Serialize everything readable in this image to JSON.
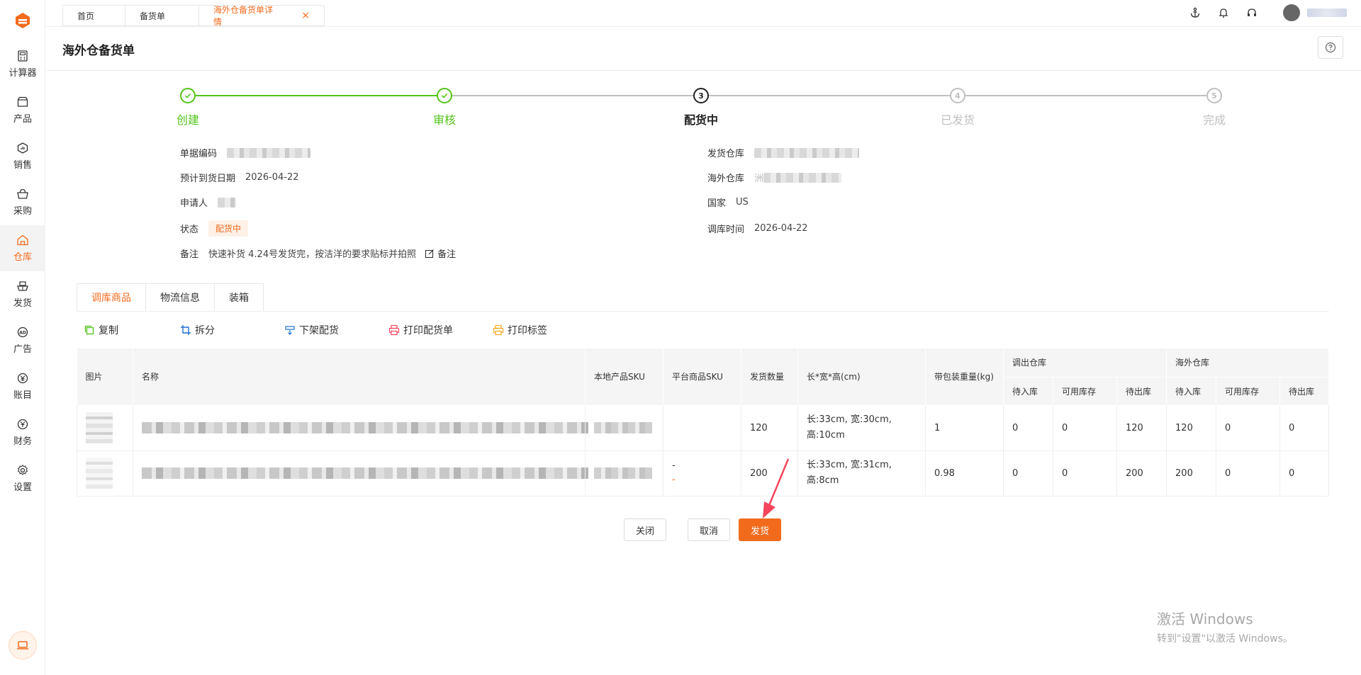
{
  "sidebar": {
    "items": [
      {
        "label": "计算器",
        "icon": "calculator-icon"
      },
      {
        "label": "产品",
        "icon": "box-icon"
      },
      {
        "label": "销售",
        "icon": "chart-icon"
      },
      {
        "label": "采购",
        "icon": "basket-icon"
      },
      {
        "label": "仓库",
        "icon": "warehouse-icon",
        "active": true
      },
      {
        "label": "发货",
        "icon": "ship-icon"
      },
      {
        "label": "广告",
        "icon": "ad-icon"
      },
      {
        "label": "账目",
        "icon": "yen-icon"
      },
      {
        "label": "财务",
        "icon": "finance-icon"
      },
      {
        "label": "设置",
        "icon": "gear-icon"
      }
    ]
  },
  "topbar": {
    "tabs": [
      {
        "label": "首页"
      },
      {
        "label": "备货单"
      },
      {
        "label": "海外仓备货单详情",
        "active": true
      }
    ],
    "close_glyph": "×"
  },
  "page": {
    "title": "海外仓备货单"
  },
  "steps": [
    {
      "label": "创建",
      "state": "done"
    },
    {
      "label": "审核",
      "state": "done"
    },
    {
      "label": "配货中",
      "state": "current",
      "num": "3"
    },
    {
      "label": "已发货",
      "state": "pending",
      "num": "4"
    },
    {
      "label": "完成",
      "state": "pending",
      "num": "5"
    }
  ],
  "info": {
    "doc_no_label": "单据编码",
    "eta_label": "预计到货日期",
    "eta_value": "2026-04-22",
    "applicant_label": "申请人",
    "status_label": "状态",
    "status_value": "配货中",
    "remark_label": "备注",
    "remark_value": "快速补货 4.24号发货完，按洁洋的要求贴标并拍照",
    "remark_edit": "备注",
    "src_wh_label": "发货仓库",
    "overseas_wh_label": "海外仓库",
    "overseas_wh_prefix": "洲",
    "country_label": "国家",
    "country_value": "US",
    "transfer_time_label": "调库时间",
    "transfer_time_value": "2026-04-22"
  },
  "content_tabs": [
    {
      "label": "调库商品",
      "active": true
    },
    {
      "label": "物流信息"
    },
    {
      "label": "装箱"
    }
  ],
  "toolbar": [
    {
      "label": "复制",
      "icon": "copy-icon",
      "color": "#52c41a"
    },
    {
      "label": "拆分",
      "icon": "crop-icon",
      "color": "#1f6fd1"
    },
    {
      "label": "下架配货",
      "icon": "shelf-icon",
      "color": "#1f6fd1"
    },
    {
      "label": "打印配货单",
      "icon": "printer-icon",
      "color": "#f5455c"
    },
    {
      "label": "打印标签",
      "icon": "printer-icon",
      "color": "#f5a623"
    }
  ],
  "table": {
    "headers": {
      "image": "图片",
      "name": "名称",
      "local_sku": "本地产品SKU",
      "platform_sku": "平台商品SKU",
      "qty": "发货数量",
      "dims": "长*宽*高(cm)",
      "weight": "带包装重量(kg)",
      "out_group": "调出仓库",
      "overseas_group": "海外仓库",
      "pending_in": "待入库",
      "available": "可用库存",
      "pending_out": "待出库"
    },
    "rows": [
      {
        "platform_sku": "",
        "platform_sku_sub": "",
        "qty": "120",
        "dims_1": "长:33cm, 宽:30cm,",
        "dims_2": "高:10cm",
        "weight": "1",
        "o_in": "0",
        "o_avail": "0",
        "o_out": "120",
        "w_in": "120",
        "w_avail": "0",
        "w_out": "0"
      },
      {
        "platform_sku": "-",
        "platform_sku_sub": "-",
        "qty": "200",
        "dims_1": "长:33cm, 宽:31cm,",
        "dims_2": "高:8cm",
        "weight": "0.98",
        "o_in": "0",
        "o_avail": "0",
        "o_out": "200",
        "w_in": "200",
        "w_avail": "0",
        "w_out": "0"
      }
    ]
  },
  "actions": {
    "close": "关闭",
    "cancel": "取消",
    "ship": "发货"
  },
  "watermark": {
    "line1": "激活 Windows",
    "line2": "转到\"设置\"以激活 Windows。"
  },
  "colors": {
    "accent": "#f26b1d",
    "done": "#52c41a"
  }
}
